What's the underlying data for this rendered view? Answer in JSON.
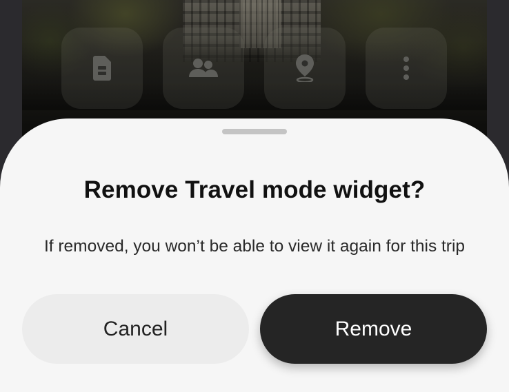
{
  "background": {
    "quick_actions": [
      {
        "icon": "sim-card-icon"
      },
      {
        "icon": "people-icon"
      },
      {
        "icon": "location-pin-icon"
      },
      {
        "icon": "more-vertical-icon"
      }
    ]
  },
  "dialog": {
    "title": "Remove Travel mode widget?",
    "message": "If removed, you won’t be able to view it again for this trip",
    "cancel_label": "Cancel",
    "remove_label": "Remove"
  },
  "colors": {
    "sheet_background": "#f6f6f6",
    "primary_button": "#252525",
    "secondary_button": "#ececec",
    "handle": "#c4c4c4"
  }
}
